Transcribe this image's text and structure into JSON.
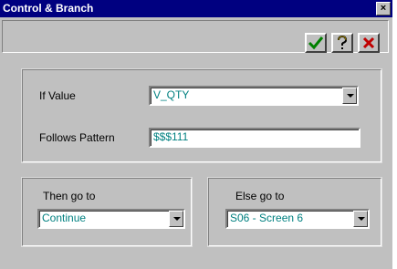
{
  "window": {
    "title": "Control & Branch",
    "close_glyph": "×"
  },
  "toolbar": {
    "ok_icon": "check-icon",
    "help_icon": "question-icon",
    "cancel_icon": "x-icon",
    "colors": {
      "ok": "#008000",
      "help": "#000000",
      "cancel": "#c00000"
    }
  },
  "condition": {
    "if_value_label": "If Value",
    "if_value": "V_QTY",
    "pattern_label": "Follows Pattern",
    "pattern_value": "$$$111"
  },
  "then_group": {
    "label": "Then go to",
    "selected": "Continue"
  },
  "else_group": {
    "label": "Else go to",
    "selected": "S06 - Screen 6"
  },
  "colors": {
    "title_bar": "#000080",
    "dialog_bg": "#c0c0c0",
    "field_text": "#008080"
  }
}
